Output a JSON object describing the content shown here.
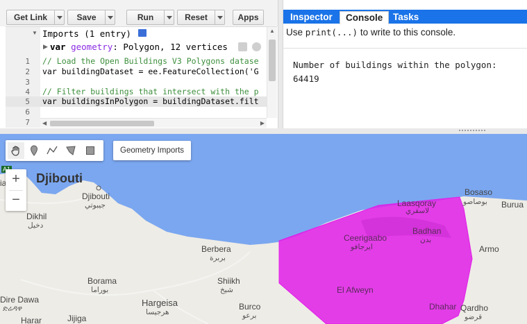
{
  "toolbar": {
    "buttons": [
      {
        "label": "Get Link",
        "has_dropdown": true
      },
      {
        "label": "Save",
        "has_dropdown": true
      },
      {
        "label": "Run",
        "has_dropdown": true
      },
      {
        "label": "Reset",
        "has_dropdown": true
      },
      {
        "label": "Apps",
        "has_dropdown": false
      }
    ]
  },
  "editor": {
    "imports_header": "Imports (1 entry)",
    "geometry_import": {
      "keyword": "var",
      "name": "geometry",
      "desc": ": Polygon, 12 vertices"
    },
    "line_numbers": [
      "1",
      "2",
      "3",
      "4",
      "5",
      "6",
      "7"
    ],
    "lines": [
      "// Load the Open Buildings V3 Polygons datase",
      "var buildingDataset = ee.FeatureCollection('G",
      "",
      "// Filter buildings that intersect with the p",
      "var buildingsInPolygon = buildingDataset.filt",
      "",
      ""
    ]
  },
  "panel": {
    "tabs": [
      "Inspector",
      "Console",
      "Tasks"
    ],
    "active_tab": "Console",
    "hint_prefix": "Use",
    "hint_code": "print(...)",
    "hint_suffix": "to write to this console.",
    "output_line1": "Number of buildings within the polygon:",
    "output_line2": "64419"
  },
  "map": {
    "geometry_imports_label": "Geometry Imports",
    "zoom_in": "+",
    "zoom_out": "−",
    "road_badge": "A1",
    "labels": [
      {
        "key": "djibouti_big",
        "text": "Djibouti"
      },
      {
        "key": "djibouti_city",
        "text": "Djibouti"
      },
      {
        "key": "djibouti_city_ar",
        "text": "جيبوتي"
      },
      {
        "key": "dikhil",
        "text": "Dikhil"
      },
      {
        "key": "dikhil_ar",
        "text": "دخيل"
      },
      {
        "key": "ia",
        "text": "ia"
      },
      {
        "key": "berbera",
        "text": "Berbera"
      },
      {
        "key": "berbera_ar",
        "text": "بربرة"
      },
      {
        "key": "boorama",
        "text": "Borama"
      },
      {
        "key": "boorama_ar",
        "text": "بوراما"
      },
      {
        "key": "sheikh",
        "text": "Shiikh"
      },
      {
        "key": "sheikh_ar",
        "text": "شيخ"
      },
      {
        "key": "hargeisa",
        "text": "Hargeisa"
      },
      {
        "key": "hargeisa_ar",
        "text": "هرجيسا"
      },
      {
        "key": "dire_dawa",
        "text": "Dire Dawa"
      },
      {
        "key": "dire_dawa_am",
        "text": "ድሬዳዋ"
      },
      {
        "key": "harar",
        "text": "Harar"
      },
      {
        "key": "jijiga",
        "text": "Jijiga"
      },
      {
        "key": "burco",
        "text": "Burco"
      },
      {
        "key": "burco_ar",
        "text": "برعو"
      },
      {
        "key": "laasqoray",
        "text": "Laasqoray"
      },
      {
        "key": "laasqoray_ar",
        "text": "لاسقري"
      },
      {
        "key": "bosaso",
        "text": "Bosaso"
      },
      {
        "key": "bosaso_ar",
        "text": "بوصاصو"
      },
      {
        "key": "burua",
        "text": "Burua"
      },
      {
        "key": "badhan",
        "text": "Badhan"
      },
      {
        "key": "badhan_ar",
        "text": "بدن"
      },
      {
        "key": "ceerigaabo",
        "text": "Ceerigaabo"
      },
      {
        "key": "ceerigaabo_ar",
        "text": "ايرجافو"
      },
      {
        "key": "elafweyn",
        "text": "El Afweyn"
      },
      {
        "key": "dhahar",
        "text": "Dhahar"
      },
      {
        "key": "qardho",
        "text": "Qardho"
      },
      {
        "key": "qardho_ar",
        "text": "قرضو"
      },
      {
        "key": "armo",
        "text": "Armo"
      }
    ],
    "polygon_color": "#e11ee8",
    "water_color": "#7ba7f0",
    "land_color": "#eeece6"
  },
  "colors": {
    "tab_bar": "#1a73e8"
  }
}
